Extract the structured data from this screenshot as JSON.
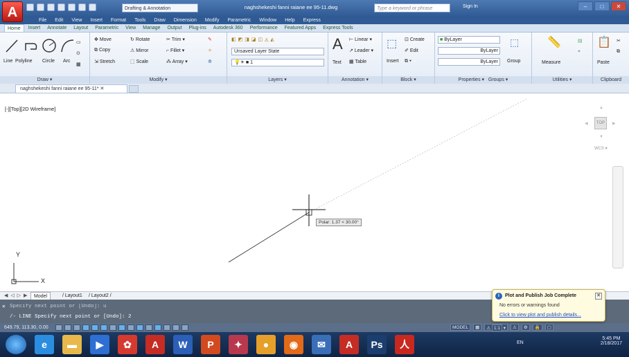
{
  "titlebar": {
    "app_letter": "A",
    "workspace": "Drafting & Annotation",
    "doc_title": "naghshekeshi fanni raiane ee 95-11.dwg",
    "search_placeholder": "Type a keyword or phrase",
    "signin": "Sign In"
  },
  "menu": [
    "File",
    "Edit",
    "View",
    "Insert",
    "Format",
    "Tools",
    "Draw",
    "Dimension",
    "Modify",
    "Parametric",
    "Window",
    "Help",
    "Express"
  ],
  "tabs": [
    "Home",
    "Insert",
    "Annotate",
    "Layout",
    "Parametric",
    "View",
    "Manage",
    "Output",
    "Plug-ins",
    "Autodesk 360",
    "Performance",
    "Featured Apps",
    "Express Tools"
  ],
  "ribbon": {
    "draw": {
      "title": "Draw",
      "line": "Line",
      "polyline": "Polyline",
      "circle": "Circle",
      "arc": "Arc"
    },
    "modify": {
      "title": "Modify",
      "move": "Move",
      "rotate": "Rotate",
      "trim": "Trim",
      "copy": "Copy",
      "mirror": "Mirror",
      "fillet": "Fillet",
      "stretch": "Stretch",
      "scale": "Scale",
      "array": "Array"
    },
    "layers": {
      "title": "Layers",
      "state": "Unsaved Layer State",
      "current": "1"
    },
    "annotation": {
      "title": "Annotation",
      "text": "Text",
      "linear": "Linear",
      "leader": "Leader",
      "table": "Table"
    },
    "block": {
      "title": "Block",
      "insert": "Insert",
      "create": "Create",
      "edit": "Edit"
    },
    "properties": {
      "title": "Properties",
      "color": "ByLayer",
      "linetype": "ByLayer",
      "lineweight": "ByLayer"
    },
    "groups": {
      "title": "Groups",
      "group": "Group"
    },
    "utilities": {
      "title": "Utilities",
      "measure": "Measure"
    },
    "clipboard": {
      "title": "Clipboard",
      "paste": "Paste"
    }
  },
  "doc_tab": "naghshekeshi fanni raiane ee 95-11*",
  "viewport_label": "[-][Top][2D Wireframe]",
  "coord_tooltip": "Polar: 1.37 < 30.00°",
  "viewcube": {
    "top": "TOP",
    "wcs": "WCS"
  },
  "ucs": {
    "x": "X",
    "y": "Y"
  },
  "layout_tabs": [
    "Model",
    "Layout1",
    "Layout2"
  ],
  "command": {
    "line1": "Specify next point or [Undo]: u",
    "line2": "/- LINE Specify next point or [Undo]: 2"
  },
  "status": {
    "coords": "649.79, 113.30, 0.00",
    "model": "MODEL",
    "scale": "1:1"
  },
  "notification": {
    "title": "Plot and Publish Job Complete",
    "message": "No errors or warnings found",
    "link": "Click to view plot and publish details..."
  },
  "taskbar": {
    "lang": "EN",
    "time": "5:45 PM",
    "date": "2/18/2017",
    "apps": [
      {
        "label": "e",
        "color": "#2b8de0"
      },
      {
        "label": "▬",
        "color": "#e8b84a"
      },
      {
        "label": "▶",
        "color": "#2e6fd1"
      },
      {
        "label": "✿",
        "color": "#d63a2e"
      },
      {
        "label": "A",
        "color": "#c52c24"
      },
      {
        "label": "W",
        "color": "#2b5fb8"
      },
      {
        "label": "P",
        "color": "#d24a1f"
      },
      {
        "label": "✦",
        "color": "#b8384e"
      },
      {
        "label": "●",
        "color": "#e6a02a"
      },
      {
        "label": "◉",
        "color": "#e26a18"
      },
      {
        "label": "✉",
        "color": "#3a6fb8"
      },
      {
        "label": "A",
        "color": "#c52c24"
      },
      {
        "label": "Ps",
        "color": "#1c3e6e"
      },
      {
        "label": "人",
        "color": "#c9281f"
      }
    ]
  }
}
